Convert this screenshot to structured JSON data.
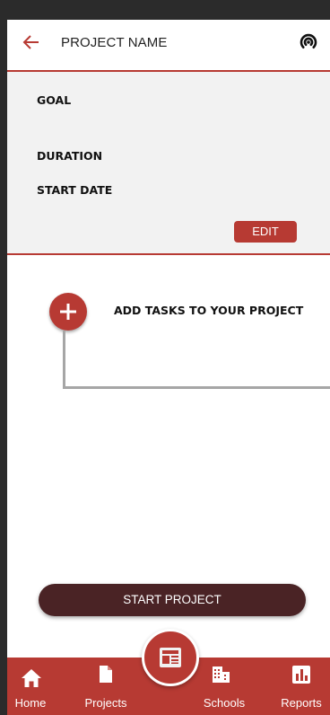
{
  "header": {
    "title": "PROJECT NAME",
    "back_icon": "arrow-left-icon",
    "right_icon": "broadcast-icon"
  },
  "project_info": {
    "goal_label": "GOAL",
    "duration_label": "DURATION",
    "start_date_label": "START DATE",
    "edit_label": "EDIT"
  },
  "tasks": {
    "add_label": "ADD TASKS TO YOUR PROJECT",
    "add_icon": "plus-icon"
  },
  "start_button_label": "START PROJECT",
  "nav": {
    "items": [
      {
        "label": "Home",
        "icon": "home-icon"
      },
      {
        "label": "Projects",
        "icon": "document-icon"
      },
      {
        "label": "Schools",
        "icon": "building-icon"
      },
      {
        "label": "Reports",
        "icon": "bar-chart-icon"
      }
    ],
    "center_icon": "newspaper-icon"
  },
  "colors": {
    "accent": "#b73a33",
    "dark_button": "#4a2325",
    "panel_bg": "#f2f2f2",
    "connector": "#a6a6a6"
  }
}
